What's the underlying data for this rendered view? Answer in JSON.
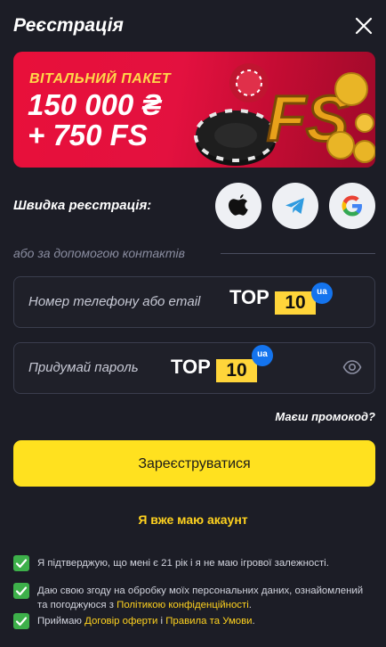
{
  "header": {
    "title": "Реєстрація"
  },
  "banner": {
    "line1": "ВІТАЛЬНИЙ ПАКЕТ",
    "line2": "150 000 ₴",
    "line3": "+ 750 FS",
    "art_text": "FS"
  },
  "quick": {
    "label": "Швидка реєстрація:",
    "providers": [
      "apple-icon",
      "telegram-icon",
      "google-icon"
    ]
  },
  "divider": {
    "text": "або за допомогою контактів"
  },
  "fields": {
    "contact_placeholder": "Номер телефону або email",
    "password_placeholder": "Придумай пароль"
  },
  "logo": {
    "top": "TOP",
    "ten": "10",
    "badge": "ua"
  },
  "promo": {
    "label": "Маєш промокод?"
  },
  "register": {
    "label": "Зареєструватися"
  },
  "account": {
    "label": "Я вже маю акаунт"
  },
  "consents": {
    "age": "Я підтверджую, що мені є 21 рік і я не маю ігрової залежності.",
    "privacy_text": "Даю свою згоду на обробку моїх персональних даних, ознайомлений та погоджуюся з ",
    "privacy_link": "Політикою конфіденційності",
    "privacy_end": ".",
    "terms_prefix": "Приймаю ",
    "terms_link1": "Договір оферти",
    "terms_mid": " і ",
    "terms_link2": "Правила та Умови",
    "terms_end": "."
  },
  "colors": {
    "background": "#1c1d26",
    "accent_yellow": "#ffe11f",
    "link_yellow": "#ffd21f",
    "banner_red": "#e8103a",
    "check_green": "#3db04a",
    "badge_blue": "#1474ee"
  }
}
